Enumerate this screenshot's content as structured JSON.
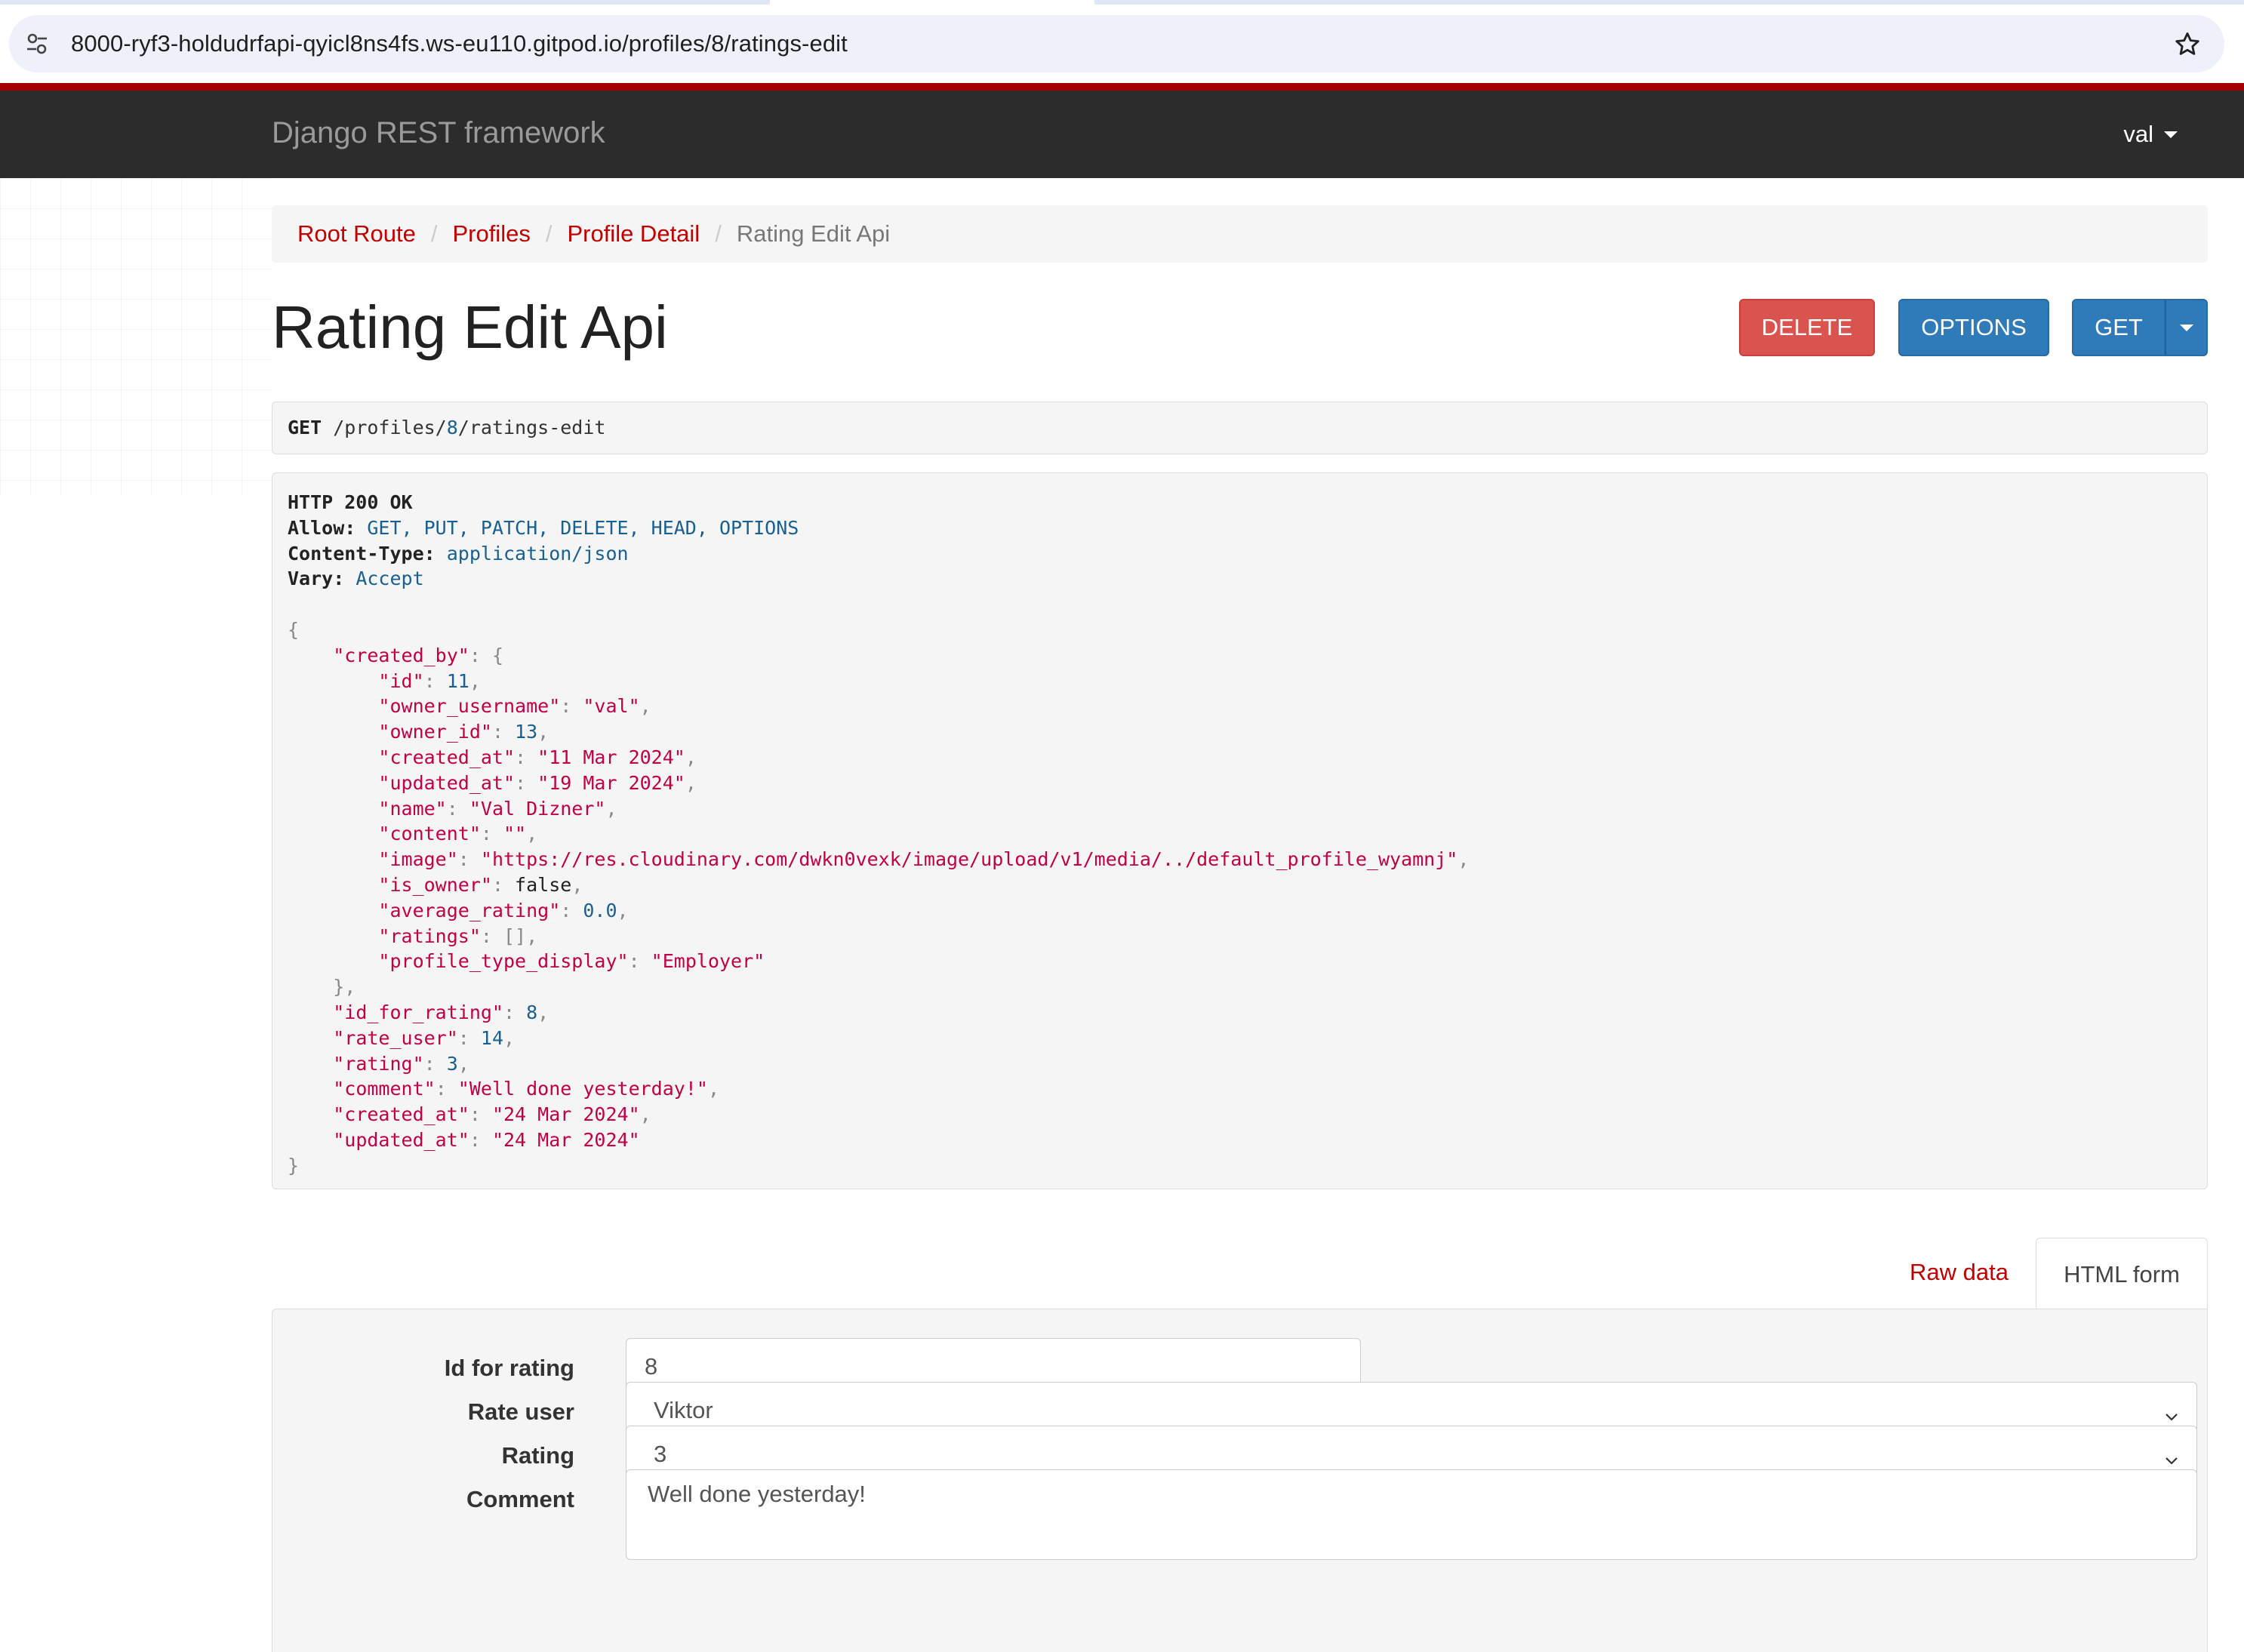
{
  "browser": {
    "url": "8000-ryf3-holdudrfapi-qyicl8ns4fs.ws-eu110.gitpod.io/profiles/8/ratings-edit"
  },
  "navbar": {
    "brand": "Django REST framework",
    "user": "val"
  },
  "breadcrumb": {
    "items": [
      "Root Route",
      "Profiles",
      "Profile Detail"
    ],
    "active": "Rating Edit Api",
    "separator": "/"
  },
  "page": {
    "title": "Rating Edit Api"
  },
  "actions": {
    "delete": "DELETE",
    "options": "OPTIONS",
    "get": "GET"
  },
  "request": {
    "method": "GET",
    "path_prefix": "/profiles/",
    "path_id": "8",
    "path_suffix": "/ratings-edit"
  },
  "response": {
    "status": "HTTP 200 OK",
    "headers": [
      {
        "name": "Allow:",
        "value": "GET, PUT, PATCH, DELETE, HEAD, OPTIONS"
      },
      {
        "name": "Content-Type:",
        "value": "application/json"
      },
      {
        "name": "Vary:",
        "value": "Accept"
      }
    ],
    "body": {
      "created_by_key": "\"created_by\"",
      "created_by": [
        {
          "key": "\"id\"",
          "value": "11",
          "type": "n"
        },
        {
          "key": "\"owner_username\"",
          "value": "\"val\"",
          "type": "s"
        },
        {
          "key": "\"owner_id\"",
          "value": "13",
          "type": "n"
        },
        {
          "key": "\"created_at\"",
          "value": "\"11 Mar 2024\"",
          "type": "s"
        },
        {
          "key": "\"updated_at\"",
          "value": "\"19 Mar 2024\"",
          "type": "s"
        },
        {
          "key": "\"name\"",
          "value": "\"Val Dizner\"",
          "type": "s"
        },
        {
          "key": "\"content\"",
          "value": "\"\"",
          "type": "s"
        },
        {
          "key": "\"image\"",
          "value": "\"https://res.cloudinary.com/dwkn0vexk/image/upload/v1/media/../default_profile_wyamnj\"",
          "type": "s"
        },
        {
          "key": "\"is_owner\"",
          "value": "false",
          "type": "bool"
        },
        {
          "key": "\"average_rating\"",
          "value": "0.0",
          "type": "n"
        },
        {
          "key": "\"ratings\"",
          "value": "[]",
          "type": "p"
        },
        {
          "key": "\"profile_type_display\"",
          "value": "\"Employer\"",
          "type": "s"
        }
      ],
      "fields": [
        {
          "key": "\"id_for_rating\"",
          "value": "8",
          "type": "n"
        },
        {
          "key": "\"rate_user\"",
          "value": "14",
          "type": "n"
        },
        {
          "key": "\"rating\"",
          "value": "3",
          "type": "n"
        },
        {
          "key": "\"comment\"",
          "value": "\"Well done yesterday!\"",
          "type": "s"
        },
        {
          "key": "\"created_at\"",
          "value": "\"24 Mar 2024\"",
          "type": "s"
        },
        {
          "key": "\"updated_at\"",
          "value": "\"24 Mar 2024\"",
          "type": "s"
        }
      ]
    }
  },
  "tabs": {
    "raw": "Raw data",
    "html": "HTML form",
    "selected": "HTML form"
  },
  "form": {
    "id_for_rating": {
      "label": "Id for rating",
      "value": "8"
    },
    "rate_user": {
      "label": "Rate user",
      "value": "Viktor"
    },
    "rating": {
      "label": "Rating",
      "value": "3"
    },
    "comment": {
      "label": "Comment",
      "value": "Well done yesterday!"
    }
  },
  "colors": {
    "navbar_bg": "#2c2c2c",
    "navbar_accent": "#a30000",
    "link": "#c20000",
    "danger": "#d9534f",
    "primary": "#2f7ab9",
    "json_key": "#c20046",
    "json_number": "#195f91"
  },
  "icons": {
    "site_info": "tune-icon",
    "bookmark": "star-icon",
    "dropdown": "caret-down-icon",
    "select": "chevron-down-icon"
  }
}
